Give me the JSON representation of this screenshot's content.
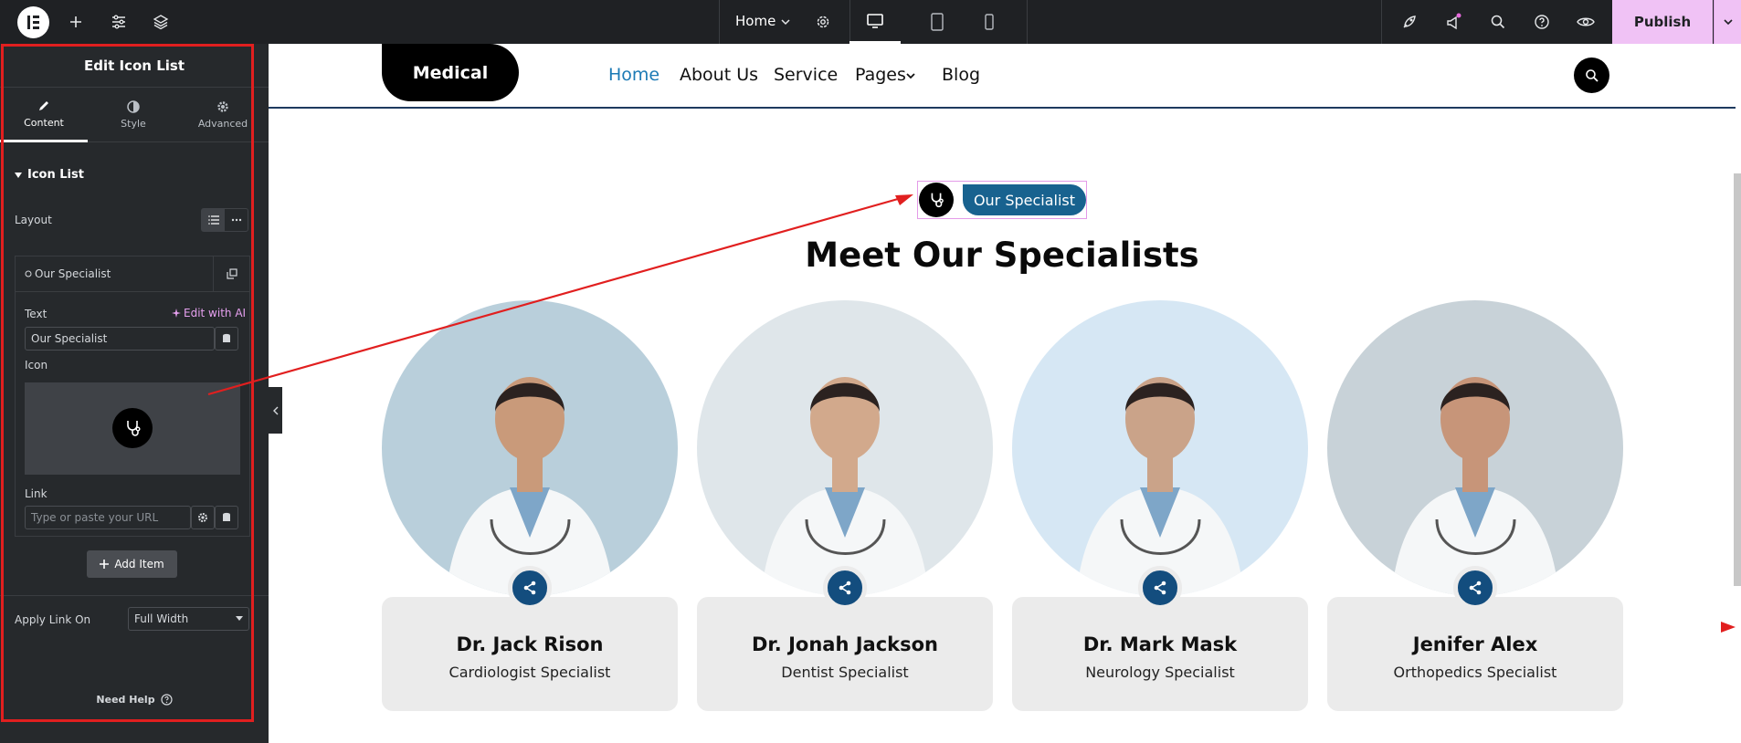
{
  "topbar": {
    "page_name": "Home",
    "publish_label": "Publish"
  },
  "panel": {
    "title": "Edit Icon List",
    "tabs": [
      {
        "label": "Content",
        "icon": "pencil-icon"
      },
      {
        "label": "Style",
        "icon": "contrast-icon"
      },
      {
        "label": "Advanced",
        "icon": "gear-icon"
      }
    ],
    "section_title": "Icon List",
    "layout_label": "Layout",
    "item_name": "Our Specialist",
    "text_label": "Text",
    "edit_ai_label": "Edit with AI",
    "text_value": "Our Specialist",
    "icon_label": "Icon",
    "link_label": "Link",
    "link_placeholder": "Type or paste your URL",
    "add_item_label": "Add Item",
    "apply_link_label": "Apply Link On",
    "apply_link_value": "Full Width",
    "help_label": "Need Help"
  },
  "site": {
    "logo": "Medical",
    "nav": [
      "Home",
      "About Us",
      "Service",
      "Pages",
      "Blog"
    ],
    "badge": "Our Specialist",
    "heading": "Meet Our Specialists",
    "doctors": [
      {
        "name": "Dr. Jack Rison",
        "role": "Cardiologist Specialist"
      },
      {
        "name": "Dr. Jonah Jackson",
        "role": "Dentist Specialist"
      },
      {
        "name": "Dr. Mark Mask",
        "role": "Neurology Specialist"
      },
      {
        "name": "Jenifer Alex",
        "role": "Orthopedics Specialist"
      }
    ]
  },
  "colors": {
    "accent_nav": "#1c7ab5",
    "badge": "#18628f",
    "share": "#134d7e",
    "publish": "#f0c2f5",
    "annotation": "#e11f1f"
  }
}
